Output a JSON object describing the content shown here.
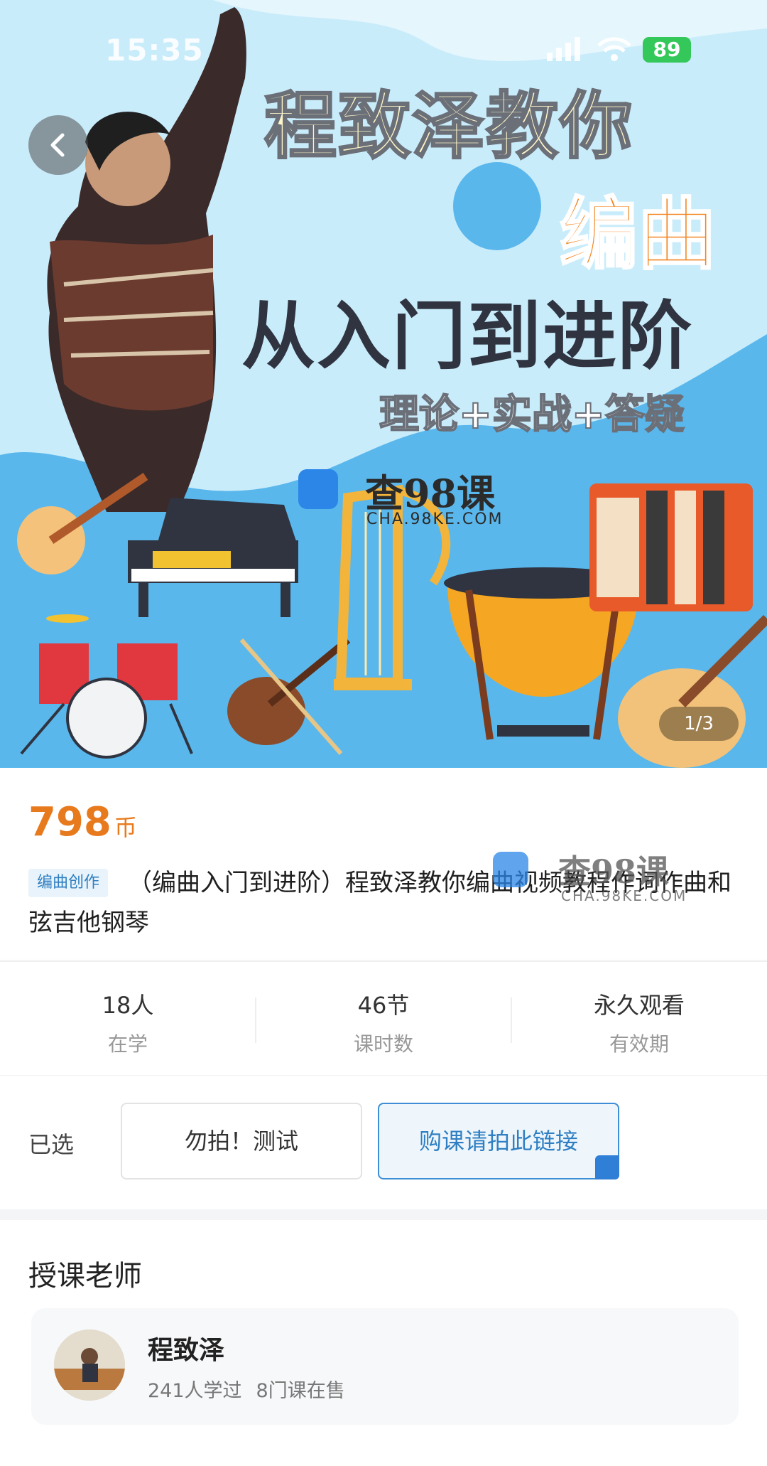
{
  "status_bar": {
    "time": "15:35",
    "battery": "89"
  },
  "hero": {
    "title_line1": "程致泽教你",
    "title_line2": "编曲",
    "title_line3": "从入门到进阶",
    "title_line4": "理论+实战+答疑",
    "watermark_text": "查98课",
    "watermark_sub": "CHA.98KE.COM",
    "page_indicator": "1/3",
    "colors": {
      "sky": "#5ab7ec",
      "accent_orange": "#f2841f"
    }
  },
  "course": {
    "price": "798",
    "price_unit": "币",
    "tag": "编曲创作",
    "title": "（编曲入门到进阶）程致泽教你编曲视频教程作词作曲和弦吉他钢琴"
  },
  "stats": [
    {
      "value": "18人",
      "label": "在学"
    },
    {
      "value": "46节",
      "label": "课时数"
    },
    {
      "value": "永久观看",
      "label": "有效期"
    }
  ],
  "selection": {
    "label": "已选",
    "options": [
      {
        "label": "勿拍！测试",
        "selected": false
      },
      {
        "label": "购课请拍此链接",
        "selected": true
      }
    ]
  },
  "teacher": {
    "heading": "授课老师",
    "name": "程致泽",
    "learners": "241人学过",
    "courses": "8门课在售"
  }
}
